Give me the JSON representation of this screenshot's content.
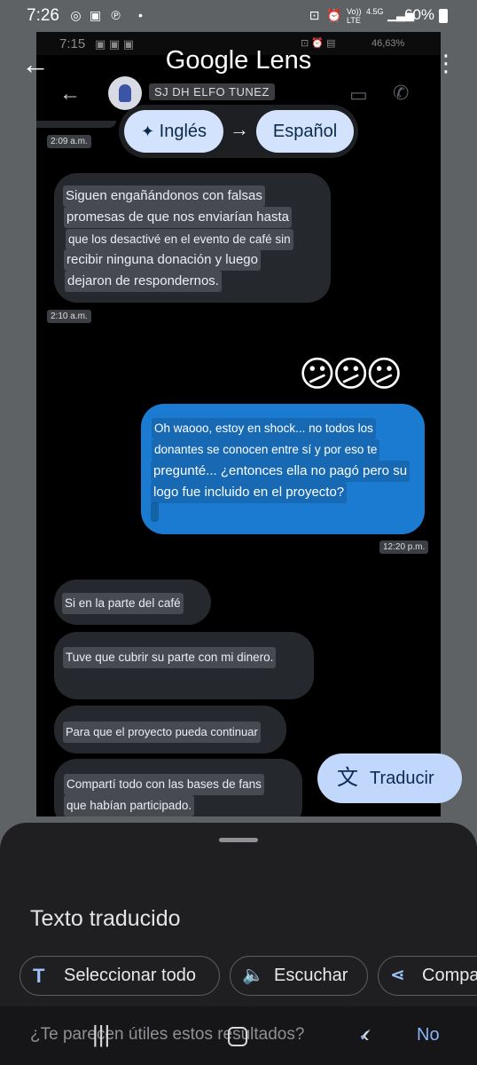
{
  "status_bar": {
    "time": "7:26",
    "battery": "60%",
    "net1": "Vo)) LTE",
    "net2": "4.5G"
  },
  "lens": {
    "title": "Google Lens"
  },
  "inner_status": {
    "time": "7:15",
    "battery": "46,63%"
  },
  "chat": {
    "contact_name": "SJ DH ELFO TUNEZ"
  },
  "languages": {
    "source": "Inglés",
    "target": "Español",
    "arrow": "→"
  },
  "messages": {
    "ts1": "2:09 a.m.",
    "m1_lines": [
      "Siguen engañándonos con falsas",
      "promesas de que nos enviarían hasta",
      "que los desactivé en el evento de café sin",
      "recibir ninguna donación y luego",
      "dejaron de respondernos."
    ],
    "ts2": "2:10 a.m.",
    "emojis": "😕😕😕",
    "m2_lines": [
      "Oh waooo, estoy en shock... no todos los",
      "donantes se conocen entre sí y por eso te",
      "pregunté... ¿entonces ella no pagó pero su",
      "logo fue incluido en el proyecto?"
    ],
    "ts3": "12:20 p.m.",
    "m3": "Si en la parte del café",
    "m4": "Tuve que cubrir su parte con mi dinero.",
    "m5": "Para que el proyecto pueda continuar",
    "m6_lines": [
      "Compartí todo con las bases de fans",
      "que habían participado."
    ]
  },
  "translate_button": {
    "label": "Traducir",
    "icon": "translate-icon"
  },
  "sheet": {
    "title": "Texto traducido",
    "actions": [
      {
        "label": "Seleccionar todo",
        "icon": "T"
      },
      {
        "label": "Escuchar",
        "icon": "speaker-icon"
      },
      {
        "label": "Compa",
        "icon": "share-icon"
      }
    ],
    "feedback_question": "¿Te parecen útiles estos resultados?",
    "feedback_no": "No"
  },
  "colors": {
    "accent": "#c2d7fc",
    "chip": "#d3e3fd",
    "sent_bubble": "#1a7bd0",
    "received_bubble": "#25282d"
  }
}
